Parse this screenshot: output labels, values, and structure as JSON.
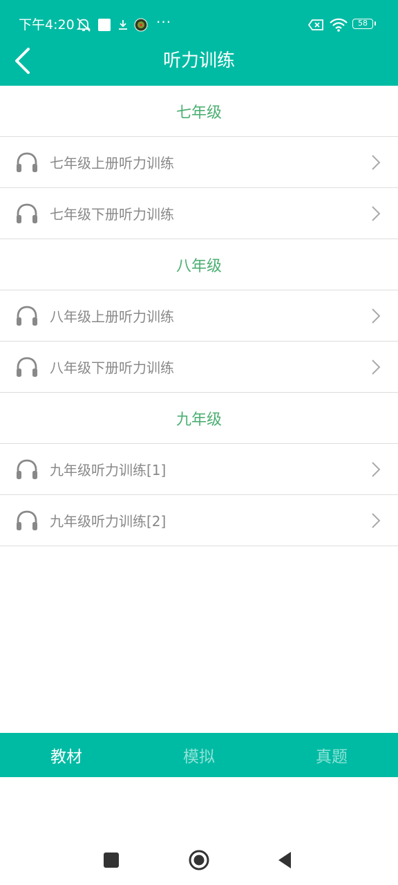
{
  "status_bar": {
    "time": "下午4:20",
    "dots": "···",
    "battery": "58"
  },
  "header": {
    "title": "听力训练"
  },
  "sections": [
    {
      "title": "七年级",
      "items": [
        {
          "label": "七年级上册听力训练"
        },
        {
          "label": "七年级下册听力训练"
        }
      ]
    },
    {
      "title": "八年级",
      "items": [
        {
          "label": "八年级上册听力训练"
        },
        {
          "label": "八年级下册听力训练"
        }
      ]
    },
    {
      "title": "九年级",
      "items": [
        {
          "label": "九年级听力训练[1]"
        },
        {
          "label": "九年级听力训练[2]"
        }
      ]
    }
  ],
  "tabs": [
    {
      "label": "教材",
      "active": true
    },
    {
      "label": "模拟",
      "active": false
    },
    {
      "label": "真题",
      "active": false
    }
  ],
  "colors": {
    "brand": "#00BBA3",
    "section_title": "#4CAF72",
    "item_text": "#888888",
    "tab_inactive": "#8FE3D7"
  }
}
